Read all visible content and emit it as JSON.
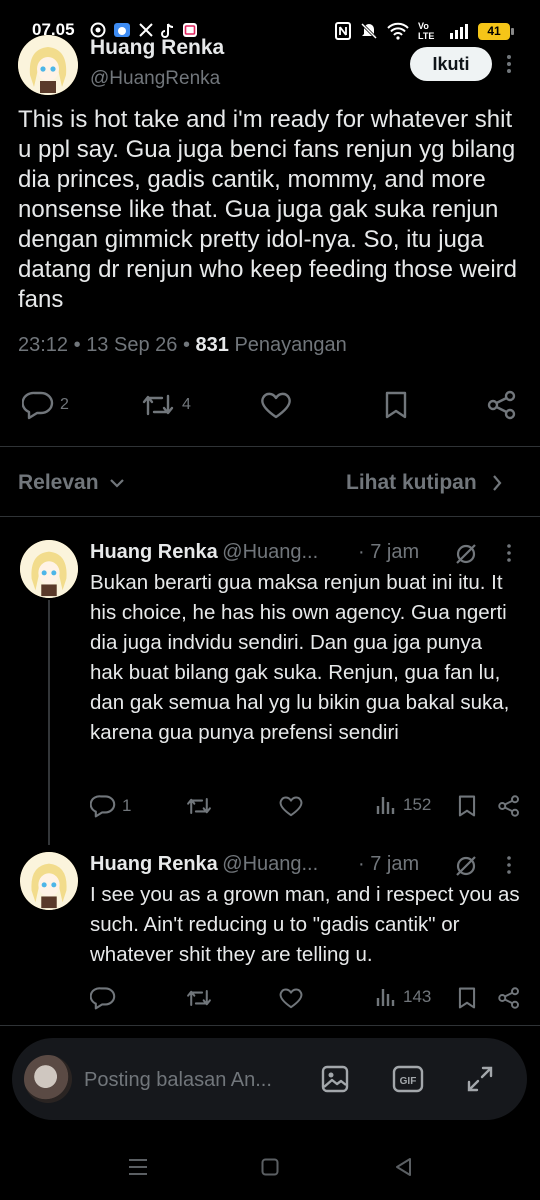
{
  "status_bar": {
    "time": "07.05",
    "battery": "41",
    "network": "Vo LTE"
  },
  "tweet": {
    "author_name": "Huang Renka",
    "author_handle": "@HuangRenka",
    "follow_label": "Ikuti",
    "text": "This is hot take and i'm ready for whatever shit u ppl say. Gua juga benci fans renjun yg bilang dia princes, gadis cantik, mommy, and more nonsense like that. Gua juga gak suka renjun dengan gimmick pretty idol-nya. So, itu juga datang dr renjun who keep feeding those weird fans",
    "time": "23:12",
    "date": "13 Sep 26",
    "views_count": "831",
    "views_label": "Penayangan",
    "reply_count": "2",
    "retweet_count": "4"
  },
  "sort": {
    "relevance_label": "Relevan",
    "quotes_label": "Lihat kutipan"
  },
  "replies": [
    {
      "author_name": "Huang Renka",
      "author_handle": "@Huang...",
      "time": "· 7 jam",
      "text": "Bukan berarti gua maksa renjun buat ini itu. It his choice, he has his own agency. Gua ngerti dia juga indvidu sendiri. Dan gua jga punya hak buat bilang gak suka. Renjun, gua fan lu, dan gak semua hal yg lu bikin gua bakal suka, karena gua punya prefensi sendiri",
      "reply_count": "1",
      "views": "152"
    },
    {
      "author_name": "Huang Renka",
      "author_handle": "@Huang...",
      "time": "· 7 jam",
      "text": "I see you as a grown man, and i respect you as such. Ain't reducing u to \"gadis cantik\" or whatever shit they are telling u.",
      "reply_count": "",
      "views": "143"
    }
  ],
  "composer": {
    "placeholder": "Posting balasan An..."
  },
  "icons": [
    "reply-icon",
    "retweet-icon",
    "like-icon",
    "bookmark-icon",
    "share-icon",
    "views-icon",
    "grok-icon",
    "image-icon",
    "gif-icon",
    "expand-icon"
  ],
  "colors": {
    "background": "#000000",
    "text": "#e7e9ea",
    "muted": "#71767b",
    "divider": "#2f3336",
    "composer_bg": "#16181c"
  }
}
